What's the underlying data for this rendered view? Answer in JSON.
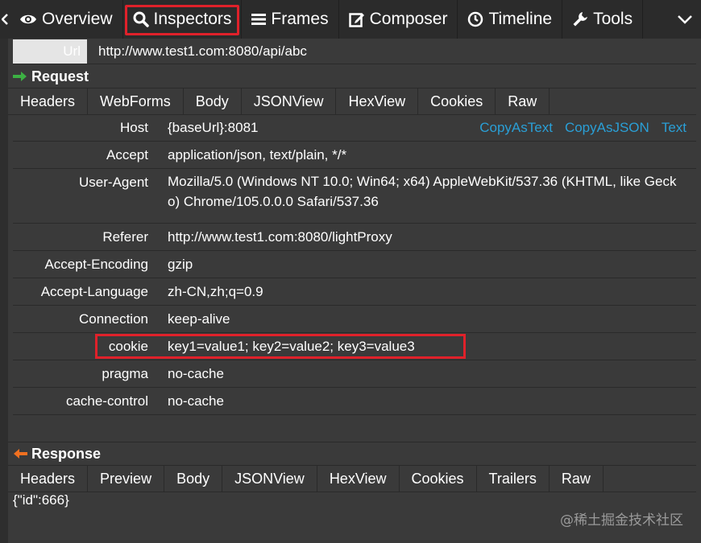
{
  "toolbar": {
    "tabs": [
      {
        "label": "Overview",
        "icon": "eye-icon"
      },
      {
        "label": "Inspectors",
        "icon": "search-icon",
        "active": true
      },
      {
        "label": "Frames",
        "icon": "list-icon"
      },
      {
        "label": "Composer",
        "icon": "edit-icon"
      },
      {
        "label": "Timeline",
        "icon": "clock-icon"
      },
      {
        "label": "Tools",
        "icon": "wrench-icon"
      }
    ]
  },
  "url": {
    "label": "Url",
    "value": "http://www.test1.com:8080/api/abc"
  },
  "request": {
    "title": "Request",
    "tabs": [
      "Headers",
      "WebForms",
      "Body",
      "JSONView",
      "HexView",
      "Cookies",
      "Raw"
    ],
    "actions": [
      "CopyAsText",
      "CopyAsJSON",
      "Text"
    ],
    "headers": [
      {
        "key": "Host",
        "value": "{baseUrl}:8081"
      },
      {
        "key": "Accept",
        "value": "application/json, text/plain, */*"
      },
      {
        "key": "User-Agent",
        "value": "Mozilla/5.0 (Windows NT 10.0; Win64; x64) AppleWebKit/537.36 (KHTML, like Gecko) Chrome/105.0.0.0 Safari/537.36"
      },
      {
        "key": "Referer",
        "value": "http://www.test1.com:8080/lightProxy"
      },
      {
        "key": "Accept-Encoding",
        "value": "gzip"
      },
      {
        "key": "Accept-Language",
        "value": "zh-CN,zh;q=0.9"
      },
      {
        "key": "Connection",
        "value": "keep-alive"
      },
      {
        "key": "cookie",
        "value": "key1=value1; key2=value2; key3=value3"
      },
      {
        "key": "pragma",
        "value": "no-cache"
      },
      {
        "key": "cache-control",
        "value": "no-cache"
      }
    ]
  },
  "response": {
    "title": "Response",
    "tabs": [
      "Headers",
      "Preview",
      "Body",
      "JSONView",
      "HexView",
      "Cookies",
      "Trailers",
      "Raw"
    ],
    "body": "{\"id\":666}"
  },
  "watermark": "@稀土掘金技术社区",
  "colors": {
    "highlight": "#e0212a",
    "link": "#2a9fd6",
    "request_arrow": "#3cb043",
    "response_arrow": "#f07020"
  }
}
